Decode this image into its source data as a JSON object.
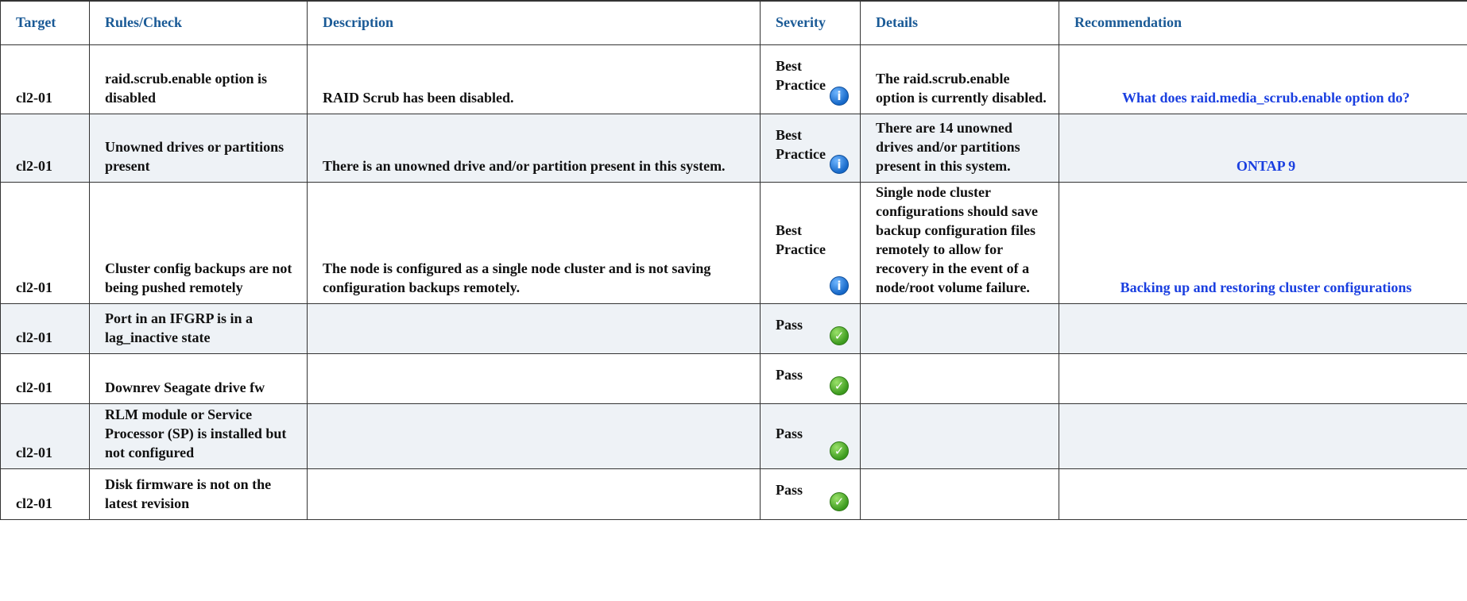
{
  "columns": [
    "Target",
    "Rules/Check",
    "Description",
    "Severity",
    "Details",
    "Recommendation"
  ],
  "rows": [
    {
      "target": "cl2-01",
      "rule": "raid.scrub.enable option is disabled",
      "description": "RAID Scrub has been disabled.",
      "severity": "Best Practice",
      "severity_icon": "info-icon",
      "details": "The raid.scrub.enable option is currently disabled.",
      "recommendation": "What does raid.media_scrub.enable option do?"
    },
    {
      "target": "cl2-01",
      "rule": "Unowned drives or partitions present",
      "description": "There is an unowned drive and/or partition present in this system.",
      "severity": "Best Practice",
      "severity_icon": "info-icon",
      "details": "There are 14 unowned drives and/or partitions present in this system.",
      "recommendation": "ONTAP 9"
    },
    {
      "target": "cl2-01",
      "rule": "Cluster config backups are not being pushed remotely",
      "description": "The node is configured as a single node cluster and is not saving configuration backups remotely.",
      "severity": "Best Practice",
      "severity_icon": "info-icon",
      "details": "Single node cluster configurations should save backup configuration files remotely to allow for recovery in the event of a node/root volume failure.",
      "recommendation": "Backing up and restoring cluster configurations"
    },
    {
      "target": "cl2-01",
      "rule": "Port in an IFGRP is in a lag_inactive state",
      "description": "",
      "severity": "Pass",
      "severity_icon": "check-icon",
      "details": "",
      "recommendation": ""
    },
    {
      "target": "cl2-01",
      "rule": "Downrev Seagate drive fw",
      "description": "",
      "severity": "Pass",
      "severity_icon": "check-icon",
      "details": "",
      "recommendation": ""
    },
    {
      "target": "cl2-01",
      "rule": "RLM module or Service Processor (SP) is installed but not configured",
      "description": "",
      "severity": "Pass",
      "severity_icon": "check-icon",
      "details": "",
      "recommendation": ""
    },
    {
      "target": "cl2-01",
      "rule": "Disk firmware is not on the latest revision",
      "description": "",
      "severity": "Pass",
      "severity_icon": "check-icon",
      "details": "",
      "recommendation": ""
    }
  ]
}
